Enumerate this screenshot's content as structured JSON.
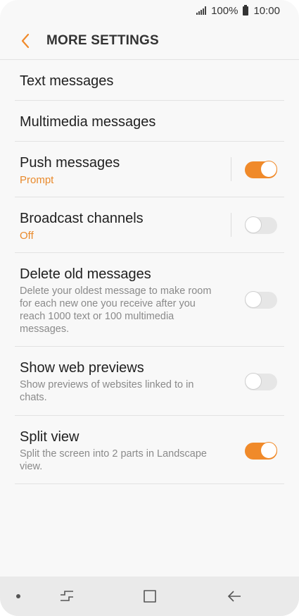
{
  "status_bar": {
    "battery": "100%",
    "time": "10:00"
  },
  "header": {
    "title": "MORE SETTINGS"
  },
  "colors": {
    "accent": "#f08a2a",
    "sub_orange": "#e98a2c",
    "background": "#f8f8f8"
  },
  "settings": [
    {
      "label": "Text messages"
    },
    {
      "label": "Multimedia messages"
    },
    {
      "label": "Push messages",
      "sub": "Prompt",
      "toggle": "on"
    },
    {
      "label": "Broadcast channels",
      "sub": "Off",
      "toggle": "off"
    },
    {
      "label": "Delete old messages",
      "desc": "Delete your oldest message to make room for each new one you receive after you reach 1000 text or 100 multimedia messages.",
      "toggle": "off"
    },
    {
      "label": "Show web previews",
      "desc": "Show previews of websites linked to in chats.",
      "toggle": "off"
    },
    {
      "label": "Split view",
      "desc": "Split the screen into 2 parts in Landscape view.",
      "toggle": "on"
    }
  ],
  "nav": {
    "icons": [
      "recents-icon",
      "home-icon",
      "back-icon"
    ]
  }
}
